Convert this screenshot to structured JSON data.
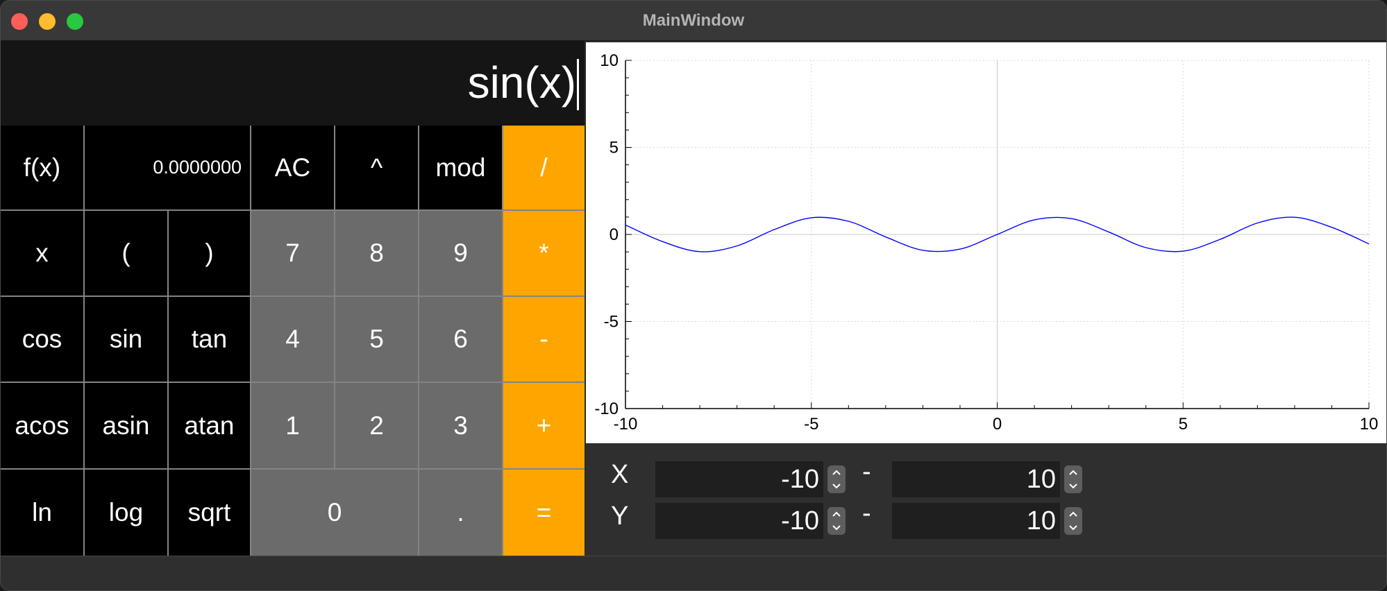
{
  "window": {
    "title": "MainWindow"
  },
  "display": {
    "expression": "sin(x)"
  },
  "keypad": {
    "fx": "f(x)",
    "result": "0.0000000",
    "ac": "AC",
    "pow": "^",
    "mod": "mod",
    "div": "/",
    "x": "x",
    "lparen": "(",
    "rparen": ")",
    "k7": "7",
    "k8": "8",
    "k9": "9",
    "mul": "*",
    "cos": "cos",
    "sin": "sin",
    "tan": "tan",
    "k4": "4",
    "k5": "5",
    "k6": "6",
    "sub": "-",
    "acos": "acos",
    "asin": "asin",
    "atan": "atan",
    "k1": "1",
    "k2": "2",
    "k3": "3",
    "add": "+",
    "ln": "ln",
    "log": "log",
    "sqrt": "sqrt",
    "k0": "0",
    "dot": ".",
    "eq": "="
  },
  "range": {
    "x_label": "X",
    "y_label": "Y",
    "separator": "-",
    "x_min": "-10",
    "x_max": "10",
    "y_min": "-10",
    "y_max": "10"
  },
  "colors": {
    "accent": "#ffa500",
    "function_key": "#000000",
    "digit_key": "#6b6b6b",
    "curve": "#0000ff"
  },
  "chart_data": {
    "type": "line",
    "function": "sin(x)",
    "xlim": [
      -10,
      10
    ],
    "ylim": [
      -10,
      10
    ],
    "x_ticks": [
      -10,
      -5,
      0,
      5,
      10
    ],
    "y_ticks": [
      10,
      5,
      0,
      -5,
      -10
    ],
    "tick_labels_x": [
      "-10",
      "-5",
      "0",
      "5",
      "10"
    ],
    "tick_labels_y": [
      "10",
      "5",
      "0",
      "-5",
      "-10"
    ],
    "grid": true,
    "series": [
      {
        "x": [
          -10,
          -9,
          -8,
          -7,
          -6,
          -5,
          -4,
          -3,
          -2,
          -1,
          0,
          1,
          2,
          3,
          4,
          5,
          6,
          7,
          8,
          9,
          10
        ],
        "values": [
          0.544,
          -0.412,
          -0.989,
          -0.657,
          0.279,
          0.959,
          0.757,
          -0.141,
          -0.909,
          -0.841,
          0,
          0.841,
          0.909,
          0.141,
          -0.757,
          -0.959,
          -0.279,
          0.657,
          0.989,
          0.412,
          -0.544
        ]
      }
    ]
  }
}
